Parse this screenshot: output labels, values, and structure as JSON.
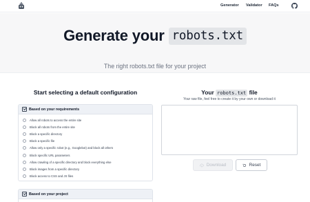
{
  "nav": {
    "logo_icon": "robot-logo-icon",
    "links": [
      "Generator",
      "Validator",
      "FAQs"
    ],
    "github_icon": "github-icon"
  },
  "hero": {
    "title_prefix": "Generate your",
    "title_code": "robots.txt",
    "subtitle": "The right robots.txt file for your project"
  },
  "left": {
    "title": "Start selecting a default configuration",
    "section1": {
      "label": "Based on your requirements",
      "options": [
        "Allow all robots to access the entire site",
        "Block all robots from the entire site",
        "Block a specific directory",
        "Block a specific file",
        "Allow only a specific robot (e.g., Googlebot) and block all others",
        "Block specific URL parameters",
        "Allow crawling of a specific directory and block everything else",
        "Block images from a specific directory",
        "Block access to CSS and JS files"
      ]
    },
    "section2": {
      "label": "Based on your project"
    }
  },
  "right": {
    "title_prefix": "Your",
    "title_code": "robots.txt",
    "title_suffix": "file",
    "subtitle": "Your raw file, feel free to create it by your own or download it",
    "textarea_value": "",
    "download_label": "Download",
    "reset_label": "Reset"
  },
  "colors": {
    "hero_bg": "#f7f7f8",
    "card_head_bg": "#eef1f6",
    "text": "#111827"
  }
}
